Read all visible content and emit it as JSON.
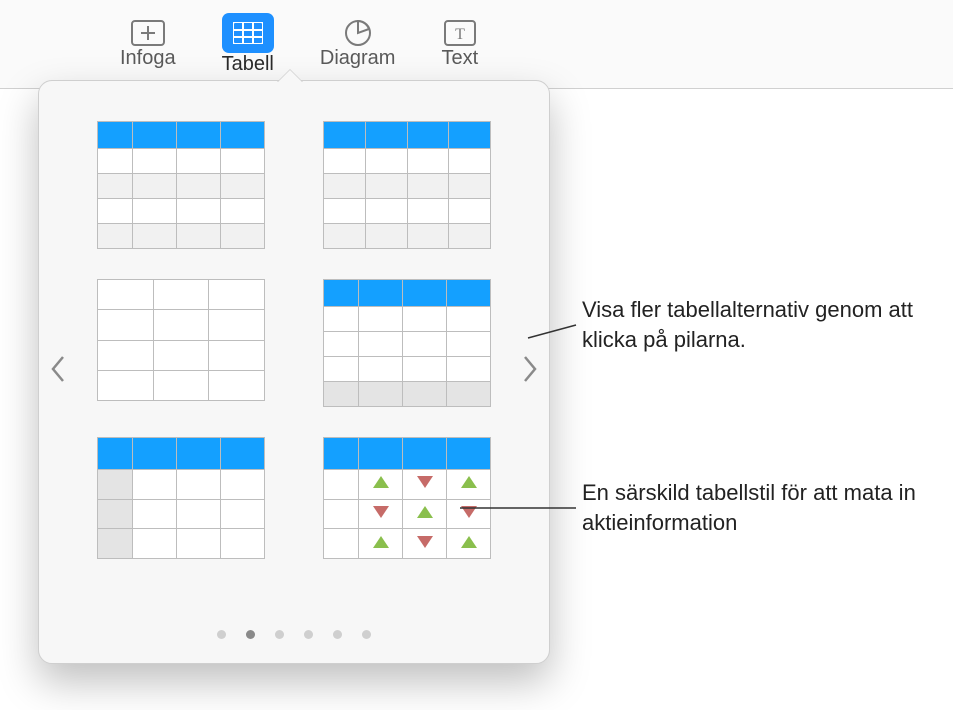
{
  "toolbar": {
    "items": [
      {
        "label": "Infoga",
        "icon": "insert-icon",
        "selected": false
      },
      {
        "label": "Tabell",
        "icon": "table-icon",
        "selected": true
      },
      {
        "label": "Diagram",
        "icon": "chart-icon",
        "selected": false
      },
      {
        "label": "Text",
        "icon": "text-icon",
        "selected": false
      }
    ]
  },
  "popover": {
    "nav_prev_icon": "chevron-left-icon",
    "nav_next_icon": "chevron-right-icon",
    "page_count": 6,
    "active_page_index": 1,
    "styles": [
      {
        "name": "table-style-header-firstcol",
        "header": true,
        "first_col": true,
        "alt_rows": true,
        "footer": false,
        "gray_first_cells": false,
        "stock_arrows": false
      },
      {
        "name": "table-style-header-altrows",
        "header": true,
        "first_col": false,
        "alt_rows": true,
        "footer": false,
        "gray_first_cells": false,
        "stock_arrows": false
      },
      {
        "name": "table-style-plain",
        "header": false,
        "first_col": false,
        "alt_rows": false,
        "footer": false,
        "gray_first_cells": false,
        "stock_arrows": false
      },
      {
        "name": "table-style-header-firstcol-footer",
        "header": true,
        "first_col": true,
        "alt_rows": false,
        "footer": true,
        "gray_first_cells": false,
        "stock_arrows": false
      },
      {
        "name": "table-style-header-grayblocks",
        "header": true,
        "first_col": true,
        "alt_rows": false,
        "footer": false,
        "gray_first_cells": true,
        "stock_arrows": false
      },
      {
        "name": "table-style-stock",
        "header": true,
        "first_col": true,
        "alt_rows": false,
        "footer": false,
        "gray_first_cells": false,
        "stock_arrows": true
      }
    ]
  },
  "callouts": {
    "arrows": "Visa fler tabellalternativ genom att klicka på pilarna.",
    "stock": "En särskild tabellstil för att mata in aktieinformation"
  }
}
